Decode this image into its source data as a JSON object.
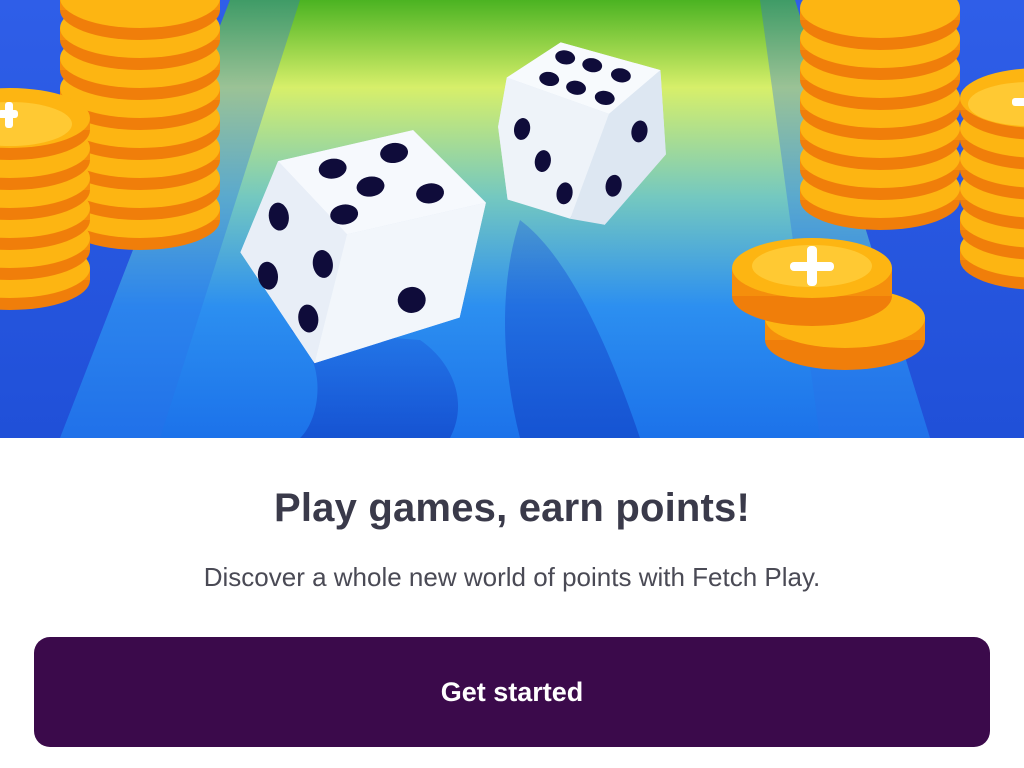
{
  "colors": {
    "button_bg": "#3b0a4b",
    "headline": "#3a3a4a",
    "subtitle": "#4a4a55",
    "coin_gold": "#fdbb12",
    "coin_orange": "#f98b0c",
    "hero_blue": "#1f5de0",
    "hero_green": "#3fb021"
  },
  "hero": {
    "icons": [
      "dice-icon",
      "coin-icon"
    ]
  },
  "content": {
    "headline": "Play games, earn points!",
    "subtitle": "Discover a whole new world of points with Fetch Play."
  },
  "actions": {
    "primary_label": "Get started"
  }
}
